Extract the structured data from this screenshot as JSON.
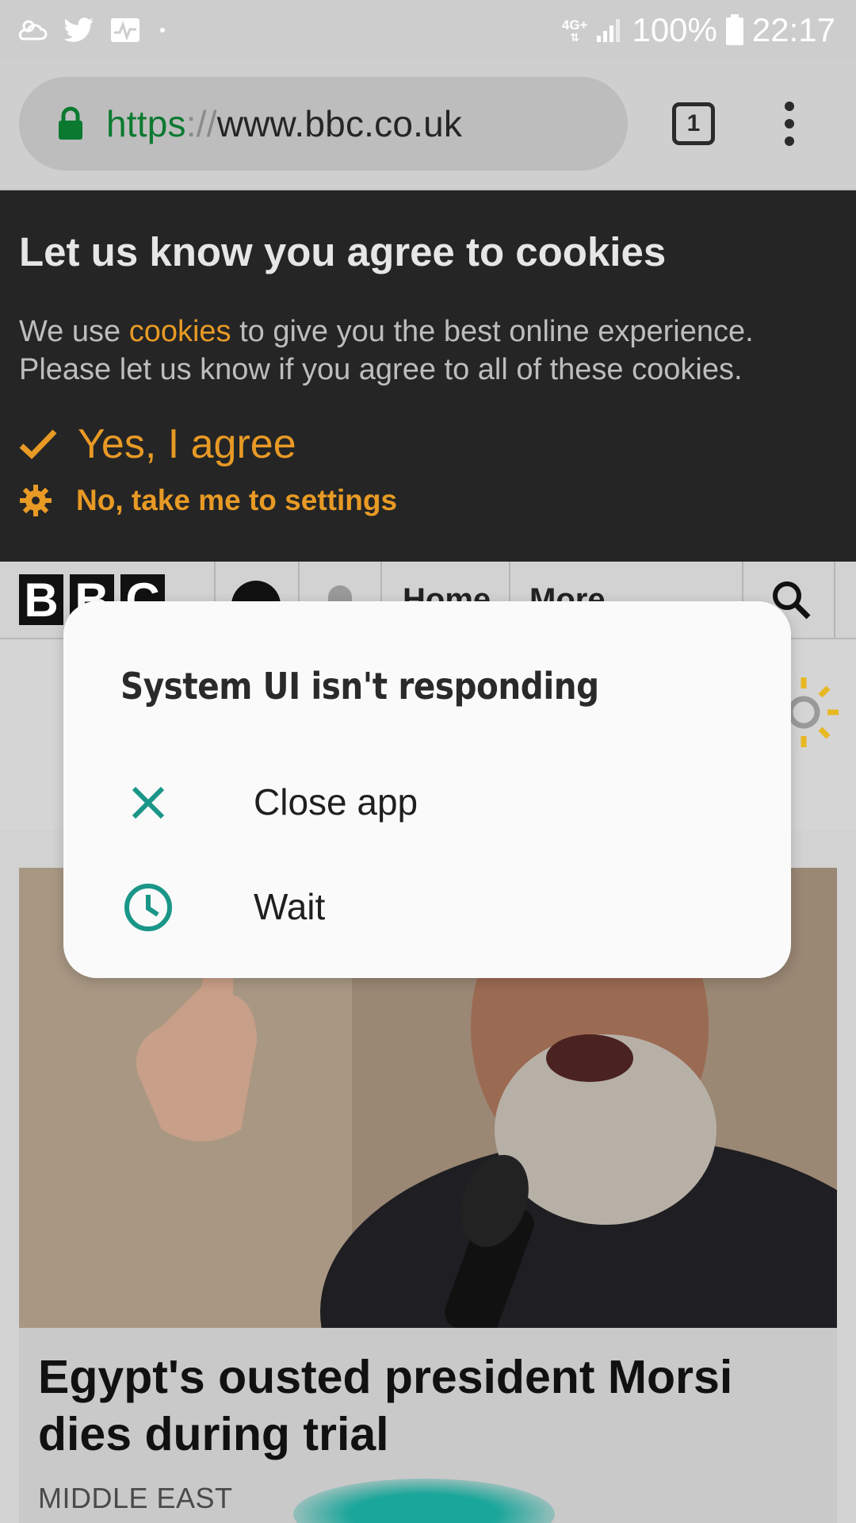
{
  "status_bar": {
    "network": "4G+",
    "battery_percent": "100%",
    "time": "22:17",
    "colors": {
      "icon": "#ffffff",
      "background": "#cdcdcd"
    }
  },
  "browser": {
    "url_scheme": "https",
    "url_separator": "://",
    "url_host": "www.bbc.co.uk",
    "tab_count": "1"
  },
  "cookie_banner": {
    "title": "Let us know you agree to cookies",
    "text_before_link": "We use ",
    "link_text": "cookies",
    "text_after_link": " to give you the best online experience. Please let us know if you agree to all of these cookies.",
    "agree_label": "Yes, I agree",
    "settings_label": "No, take me to settings",
    "accent_color": "#e89a25"
  },
  "bbc_nav": {
    "logo": [
      "B",
      "B",
      "C"
    ],
    "items": [
      "Home",
      "More"
    ]
  },
  "article": {
    "headline": "Egypt's ousted president Morsi dies during trial",
    "section": "MIDDLE EAST"
  },
  "dialog": {
    "title": "System UI isn't responding",
    "options": [
      {
        "label": "Close app",
        "icon": "close-icon"
      },
      {
        "label": "Wait",
        "icon": "clock-icon"
      }
    ],
    "accent_color": "#1a9688"
  }
}
